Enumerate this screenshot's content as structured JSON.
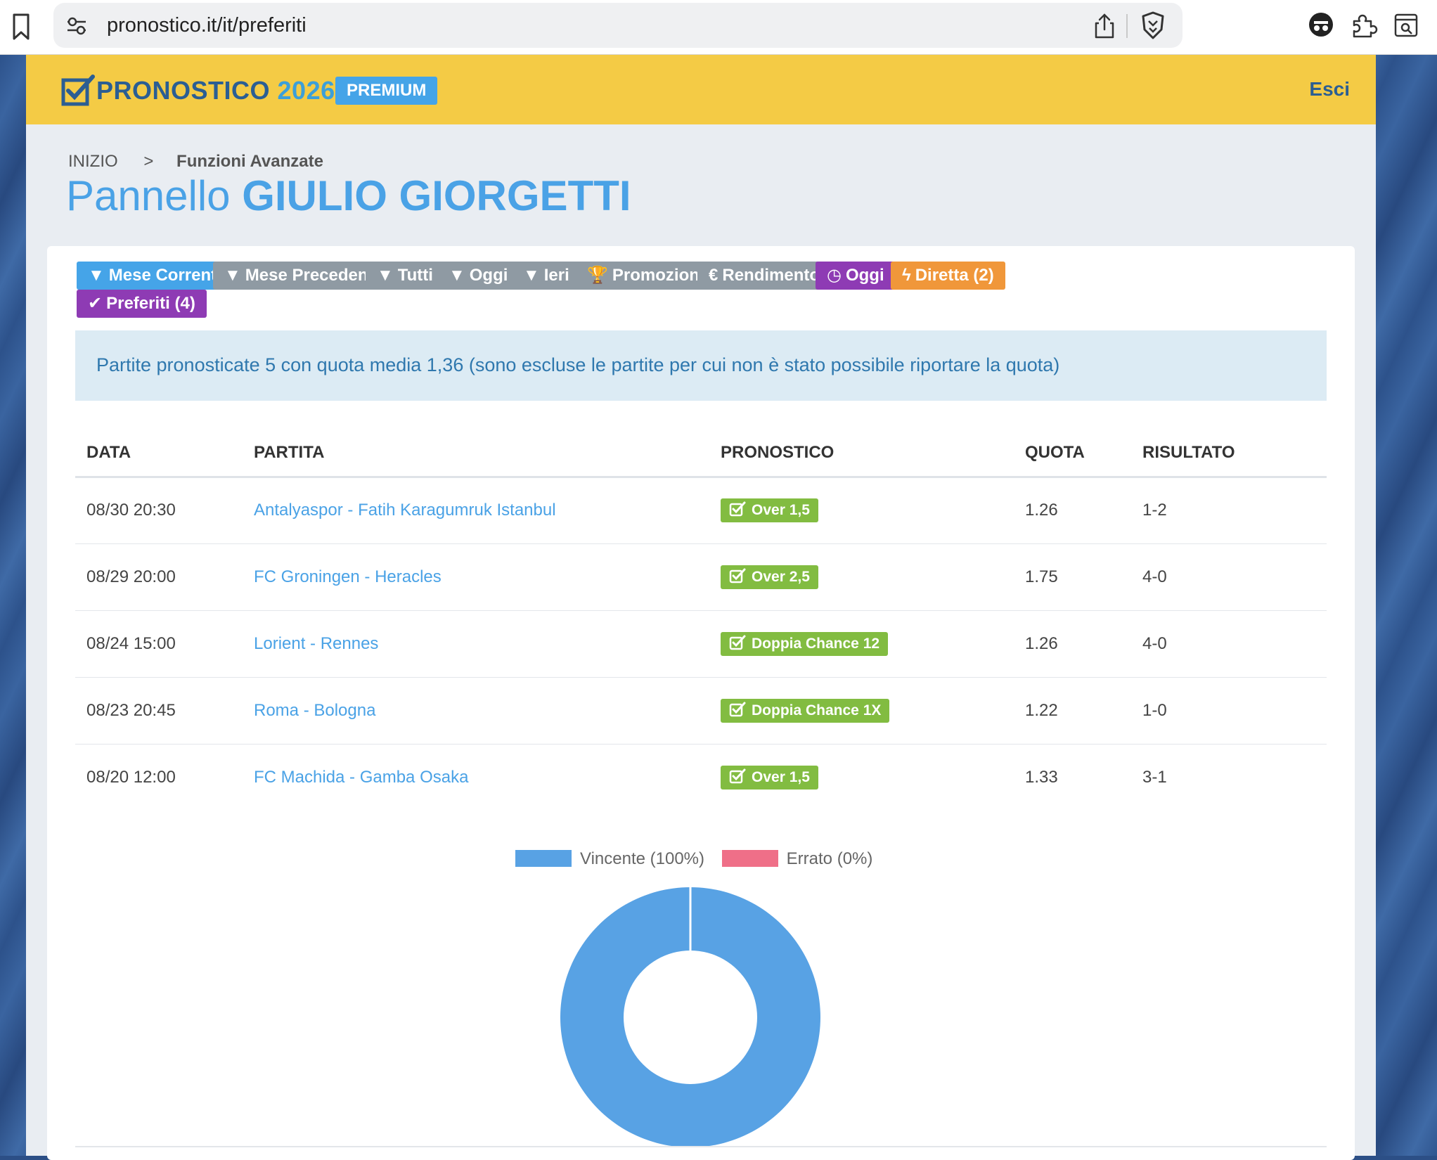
{
  "browser": {
    "url": "pronostico.it/it/preferiti"
  },
  "header": {
    "logo_main": "PRONOSTICO",
    "logo_year": "2026",
    "premium": "PREMIUM",
    "logout": "Esci"
  },
  "breadcrumb": {
    "home": "INIZIO",
    "separator": ">",
    "current": "Funzioni Avanzate"
  },
  "title": {
    "prefix": "Pannello",
    "name": "GIULIO GIORGETTI"
  },
  "filters": [
    {
      "label": "Mese Corrente",
      "icon": "filter-icon",
      "glyph": "▼",
      "color": "#45a4e8"
    },
    {
      "label": "Mese Precedente",
      "icon": "filter-icon",
      "glyph": "▼",
      "color": "#8f9aa3"
    },
    {
      "label": "Tutti",
      "icon": "filter-icon",
      "glyph": "▼",
      "color": "#8f9aa3"
    },
    {
      "label": "Oggi",
      "icon": "filter-icon",
      "glyph": "▼",
      "color": "#8f9aa3"
    },
    {
      "label": "Ieri",
      "icon": "filter-icon",
      "glyph": "▼",
      "color": "#8f9aa3"
    },
    {
      "label": "Promozione",
      "icon": "trophy-icon",
      "glyph": "🏆",
      "color": "#8f9aa3"
    },
    {
      "label": "Rendimento",
      "icon": "euro-icon",
      "glyph": "€",
      "color": "#8f9aa3"
    },
    {
      "label": "Oggi",
      "icon": "clock-icon",
      "glyph": "◷",
      "color": "#8e3bb4"
    },
    {
      "label": "Diretta (2)",
      "icon": "bolt-icon",
      "glyph": "ϟ",
      "color": "#f0973a"
    },
    {
      "label": "Preferiti (4)",
      "icon": "check-icon",
      "glyph": "✔",
      "color": "#8e3bb4"
    }
  ],
  "info": "Partite pronosticate 5 con quota media 1,36 (sono escluse le partite per cui non è stato possibile riportare la quota)",
  "table": {
    "headers": {
      "date": "DATA",
      "match": "PARTITA",
      "pick": "PRONOSTICO",
      "odds": "QUOTA",
      "result": "RISULTATO"
    },
    "rows": [
      {
        "date": "08/30 20:30",
        "match": "Antalyaspor - Fatih Karagumruk Istanbul",
        "pick": "Over 1,5",
        "odds": "1.26",
        "result": "1-2"
      },
      {
        "date": "08/29 20:00",
        "match": "FC Groningen - Heracles",
        "pick": "Over 2,5",
        "odds": "1.75",
        "result": "4-0"
      },
      {
        "date": "08/24 15:00",
        "match": "Lorient - Rennes",
        "pick": "Doppia Chance 12",
        "odds": "1.26",
        "result": "4-0"
      },
      {
        "date": "08/23 20:45",
        "match": "Roma - Bologna",
        "pick": "Doppia Chance 1X",
        "odds": "1.22",
        "result": "1-0"
      },
      {
        "date": "08/20 12:00",
        "match": "FC Machida - Gamba Osaka",
        "pick": "Over 1,5",
        "odds": "1.33",
        "result": "3-1"
      }
    ]
  },
  "chart_data": {
    "type": "pie",
    "categories": [
      "Vincente (100%)",
      "Errato (0%)"
    ],
    "values": [
      100,
      0
    ],
    "colors": [
      "#58a2e4",
      "#ef6f88"
    ],
    "legend": "top"
  }
}
